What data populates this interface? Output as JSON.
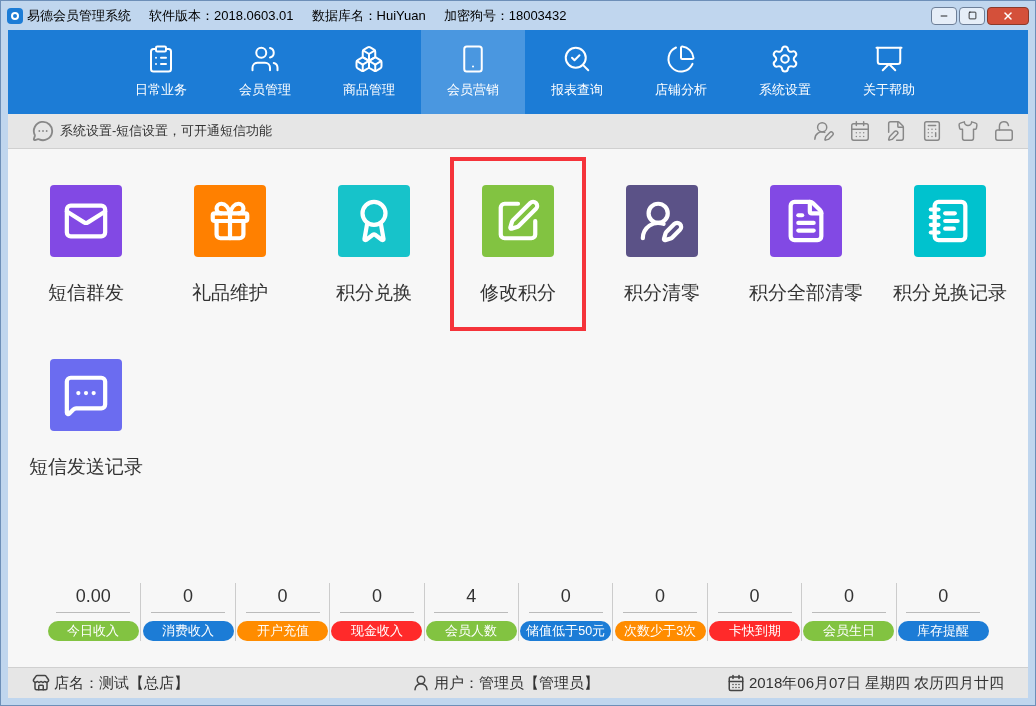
{
  "window": {
    "title": "易德会员管理系统",
    "version": "软件版本：2018.0603.01",
    "database": "数据库名：HuiYuan",
    "dongle": "加密狗号：18003432"
  },
  "nav": [
    {
      "label": "日常业务",
      "kind": "clipboard",
      "selected": false
    },
    {
      "label": "会员管理",
      "kind": "users",
      "selected": false
    },
    {
      "label": "商品管理",
      "kind": "boxes",
      "selected": false
    },
    {
      "label": "会员营销",
      "kind": "phone",
      "selected": true
    },
    {
      "label": "报表查询",
      "kind": "search",
      "selected": false
    },
    {
      "label": "店铺分析",
      "kind": "pie",
      "selected": false
    },
    {
      "label": "系统设置",
      "kind": "gear",
      "selected": false
    },
    {
      "label": "关于帮助",
      "kind": "help",
      "selected": false
    }
  ],
  "notice": "系统设置-短信设置，可开通短信功能",
  "tiles": [
    {
      "label": "短信群发",
      "kind": "mail",
      "color": "#8249e4",
      "selected": false
    },
    {
      "label": "礼品维护",
      "kind": "gift",
      "color": "#ff8000",
      "selected": false
    },
    {
      "label": "积分兑换",
      "kind": "award",
      "color": "#17c3ca",
      "selected": false
    },
    {
      "label": "修改积分",
      "kind": "edit",
      "color": "#82c341",
      "selected": true
    },
    {
      "label": "积分清零",
      "kind": "userpen",
      "color": "#5b5287",
      "selected": false
    },
    {
      "label": "积分全部清零",
      "kind": "filerefresh",
      "color": "#8249e4",
      "selected": false
    },
    {
      "label": "积分兑换记录",
      "kind": "notebook",
      "color": "#00c2ce",
      "selected": false
    },
    {
      "label": "短信发送记录",
      "kind": "chat",
      "color": "#6b6cf0",
      "selected": false
    }
  ],
  "stats": [
    {
      "value": "0.00",
      "label": "今日收入",
      "color": "#82c341"
    },
    {
      "value": "0",
      "label": "消费收入",
      "color": "#1c7cd6"
    },
    {
      "value": "0",
      "label": "开户充值",
      "color": "#ff8c00"
    },
    {
      "value": "0",
      "label": "现金收入",
      "color": "#ff2a2a"
    },
    {
      "value": "4",
      "label": "会员人数",
      "color": "#82c341"
    },
    {
      "value": "0",
      "label": "储值低于50元",
      "color": "#1c7cd6"
    },
    {
      "value": "0",
      "label": "次数少于3次",
      "color": "#ff8c00"
    },
    {
      "value": "0",
      "label": "卡快到期",
      "color": "#ff2a2a"
    },
    {
      "value": "0",
      "label": "会员生日",
      "color": "#82c341"
    },
    {
      "value": "0",
      "label": "库存提醒",
      "color": "#1c7cd6"
    }
  ],
  "status_bar": {
    "store": "店名：测试【总店】",
    "user": "用户：管理员【管理员】",
    "date": "2018年06月07日 星期四 农历四月廿四"
  }
}
